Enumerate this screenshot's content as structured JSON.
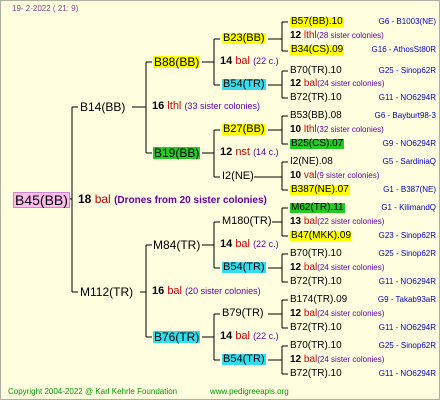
{
  "header": "19-  2-2022 ( 21:  9)",
  "footer": {
    "copyright": "Copyright 2004-2022 @ Karl Kehrle Foundation",
    "url": "www.pedigreeapis.org"
  },
  "root": {
    "id": "B45(BB)",
    "line": {
      "num": "18",
      "label": "bal",
      "note": "(Drones from 20 sister colonies)"
    }
  },
  "sire_side": {
    "id": "B14(BB)",
    "line": {
      "num": "16",
      "label": "lthl",
      "note": "(33 sister colonies)"
    },
    "upper": {
      "id": "B88(BB)",
      "line": {
        "num": "14",
        "label": "bal",
        "note": "(22 c.)"
      },
      "top": {
        "id": "B23(BB)",
        "line": {
          "num": "12",
          "label": "lthl",
          "note": "(28 sister colonies)"
        },
        "sire": "B57(BB).10",
        "dam": "B34(CS).09",
        "sire_ref": "G6 - B1003(NE)",
        "dam_ref": "G16 - AthosSt80R"
      },
      "bottom": {
        "id": "B54(TR)",
        "line": {
          "num": "12",
          "label": "bal",
          "note": "(24 sister colonies)"
        },
        "sire": "B70(TR).10",
        "dam": "B72(TR).10",
        "sire_ref": "G25 - Sinop62R",
        "dam_ref": "G11 - NO6294R"
      }
    },
    "lower": {
      "id": "B19(BB)",
      "line": {
        "num": "12",
        "label": "nst",
        "note": "(14 c.)"
      },
      "top": {
        "id": "B27(BB)",
        "line": {
          "num": "10",
          "label": "lthl",
          "note": "(32 sister colonies)"
        },
        "sire": "B53(BB).08",
        "dam": "B25(CS).07",
        "sire_ref": "G6 - Bayburt98-3",
        "dam_ref": "G9 - NO6294R"
      },
      "bottom": {
        "id": "I2(NE)",
        "line": {
          "num": "10",
          "label": "val",
          "note": "(9 sister colonies)"
        },
        "sire": "I2(NE).08",
        "dam": "B387(NE).07",
        "sire_ref": "G5 - SardiniaQ",
        "dam_ref": "G1 - B387(NE)"
      }
    }
  },
  "dam_side": {
    "id": "M112(TR)",
    "line": {
      "num": "16",
      "label": "bal",
      "note": "(20 sister colonies)"
    },
    "upper": {
      "id": "M84(TR)",
      "line": {
        "num": "14",
        "label": "bal",
        "note": "(22 c.)"
      },
      "top": {
        "id": "M180(TR)",
        "line": {
          "num": "13",
          "label": "bal",
          "note": "(22 sister colonies)"
        },
        "sire": "M62(TR).11",
        "dam": "B47(MKK).09",
        "sire_ref": "G1 - KilimandQ",
        "dam_ref": "G23 - Sinop62R"
      },
      "bottom": {
        "id": "B54(TR)",
        "line": {
          "num": "12",
          "label": "bal",
          "note": "(24 sister colonies)"
        },
        "sire": "B70(TR).10",
        "dam": "B72(TR).10",
        "sire_ref": "G25 - Sinop62R",
        "dam_ref": "G11 - NO6294R"
      }
    },
    "lower": {
      "id": "B76(TR)",
      "line": {
        "num": "14",
        "label": "bal",
        "note": "(22 c.)"
      },
      "top": {
        "id": "B79(TR)",
        "line": {
          "num": "12",
          "label": "bal",
          "note": "(24 sister colonies)"
        },
        "sire": "B174(TR).09",
        "dam": "B72(TR).10",
        "sire_ref": "G9 - Takab93aR",
        "dam_ref": "G11 - NO6294R"
      },
      "bottom": {
        "id": "B54(TR)",
        "line": {
          "num": "12",
          "label": "bal",
          "note": "(24 sister colonies)"
        },
        "sire": "B70(TR).10",
        "dam": "B72(TR).10",
        "sire_ref": "G25 - Sinop62R",
        "dam_ref": "G11 - NO6294R"
      }
    }
  }
}
